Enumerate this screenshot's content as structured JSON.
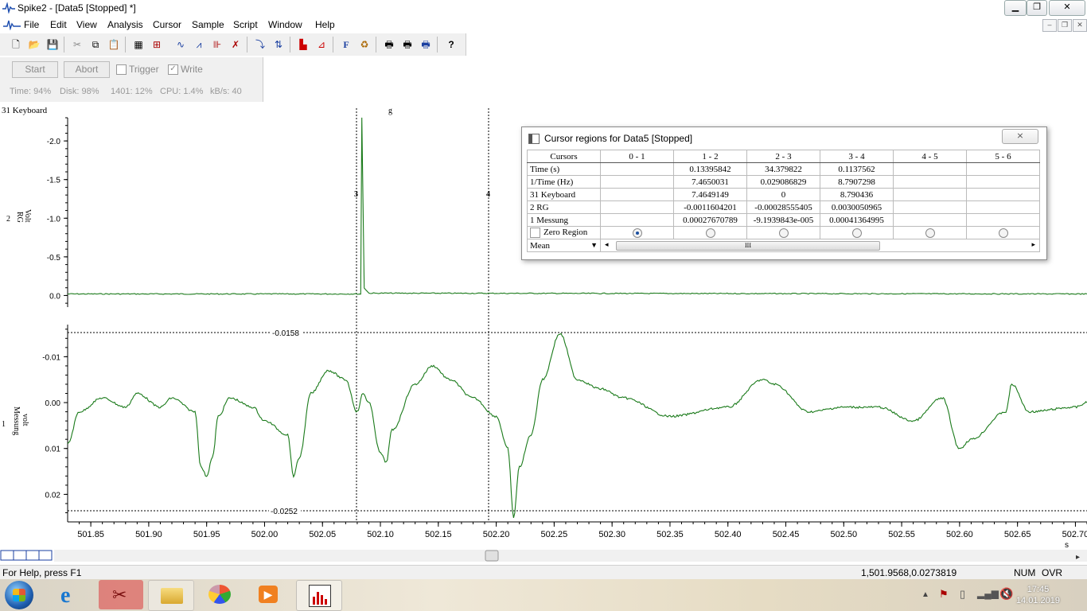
{
  "window": {
    "title": "Spike2 - [Data5 [Stopped] *]"
  },
  "menu": [
    "File",
    "Edit",
    "View",
    "Analysis",
    "Cursor",
    "Sample",
    "Script",
    "Window",
    "Help"
  ],
  "sample_bar": {
    "start_label": "Start",
    "abort_label": "Abort",
    "trigger_label": "Trigger",
    "write_label": "Write"
  },
  "sample_status": {
    "time": "Time: 94%",
    "disk": "Disk:  98%",
    "buffer": "1401: 12%",
    "cpu": "CPU:  1.4%",
    "kbs": "kB/s:  40"
  },
  "channels": {
    "keyboard": {
      "label": "31 Keyboard",
      "marker": "g"
    },
    "rg": {
      "number": "2",
      "name": "RG",
      "unit": "Volt",
      "ticks": [
        "-2.0",
        "-1.5",
        "-1.0",
        "-0.5",
        "0.0"
      ]
    },
    "messung": {
      "number": "1",
      "name": "Messung",
      "unit": "volt",
      "ticks": [
        "-0.01",
        "0.00",
        "0.01",
        "0.02"
      ]
    }
  },
  "cursors": {
    "c3": "3",
    "c4": "4",
    "hcursor_top": "-0.0158",
    "hcursor_bottom": "-0.0252"
  },
  "x_axis": {
    "ticks": [
      "501.85",
      "501.90",
      "501.95",
      "502.00",
      "502.05",
      "502.10",
      "502.15",
      "502.20",
      "502.25",
      "502.30",
      "502.35",
      "502.40",
      "502.45",
      "502.50",
      "502.55",
      "502.60",
      "502.65",
      "502.70"
    ],
    "unit": "s"
  },
  "trace_color": "#1a7a1a",
  "chart_data": {
    "type": "line",
    "series": [
      {
        "name": "RG",
        "x_range": [
          501.83,
          502.71
        ],
        "description_points": [
          [
            501.83,
            -0.02
          ],
          [
            502.083,
            -0.02
          ],
          [
            502.084,
            -2.3
          ],
          [
            502.086,
            -0.1
          ],
          [
            502.09,
            -0.03
          ],
          [
            502.71,
            -0.02
          ]
        ]
      },
      {
        "name": "Messung",
        "x": [
          501.83,
          501.84,
          501.86,
          501.88,
          501.89,
          501.91,
          501.92,
          501.94,
          501.945,
          501.95,
          501.955,
          501.96,
          501.97,
          501.99,
          502.0,
          502.02,
          502.025,
          502.03,
          502.04,
          502.055,
          502.07,
          502.08,
          502.085,
          502.09,
          502.1,
          502.105,
          502.11,
          502.13,
          502.145,
          502.16,
          502.18,
          502.2,
          502.21,
          502.215,
          502.22,
          502.23,
          502.24,
          502.255,
          502.27,
          502.29,
          502.31,
          502.35,
          502.4,
          502.43,
          502.44,
          502.47,
          502.5,
          502.53,
          502.56,
          502.585,
          502.6,
          502.61,
          502.64,
          502.645,
          502.66,
          502.7,
          502.71
        ],
        "y": [
          0.009,
          0.002,
          -0.001,
          0.001,
          -0.002,
          0.001,
          -0.001,
          0.002,
          0.014,
          0.016,
          0.012,
          0.003,
          -0.001,
          0.001,
          0.004,
          0.007,
          0.016,
          0.012,
          -0.002,
          -0.007,
          -0.005,
          0.002,
          -0.002,
          0.0,
          0.011,
          0.013,
          0.006,
          -0.004,
          -0.008,
          -0.005,
          -0.001,
          0.003,
          0.01,
          0.025,
          0.014,
          0.007,
          -0.005,
          -0.015,
          -0.005,
          -0.003,
          -0.001,
          0.003,
          0.001,
          -0.005,
          -0.004,
          0.002,
          0.001,
          0.001,
          0.004,
          -0.001,
          0.01,
          0.008,
          0.002,
          -0.004,
          0.002,
          0.001,
          0.0
        ]
      }
    ],
    "xlabel": "s",
    "xlim": [
      501.83,
      502.71
    ],
    "rg_ylim": [
      -2.3,
      0.15
    ],
    "messung_ylim": [
      -0.017,
      0.026
    ]
  },
  "dialog": {
    "title": "Cursor regions for Data5 [Stopped]",
    "close_label": "⨯",
    "columns": [
      "Cursors",
      "0 - 1",
      "1 - 2",
      "2 - 3",
      "3 - 4",
      "4 - 5",
      "5 - 6"
    ],
    "rows": [
      {
        "label": "Time (s)",
        "values": [
          "",
          "0.13395842",
          "34.379822",
          "0.1137562",
          "",
          ""
        ]
      },
      {
        "label": "1/Time (Hz)",
        "values": [
          "",
          "7.4650031",
          "0.029086829",
          "8.7907298",
          "",
          ""
        ]
      },
      {
        "label": "31 Keyboard",
        "values": [
          "",
          "7.4649149",
          "0",
          "8.790436",
          "",
          ""
        ]
      },
      {
        "label": "2 RG",
        "values": [
          "",
          "-0.0011604201",
          "-0.00028555405",
          "0.0030050965",
          "",
          ""
        ]
      },
      {
        "label": "1 Messung",
        "values": [
          "",
          "0.00027670789",
          "-9.1939843e-005",
          "0.00041364995",
          "",
          ""
        ]
      }
    ],
    "zero_region_label": "Zero Region",
    "mode_label": "Mean",
    "scroll_grip": "III"
  },
  "status": {
    "help": "For Help, press F1",
    "position": "1,501.9568,0.0273819",
    "num": "NUM",
    "ovr": "OVR"
  },
  "taskbar": {
    "time": "17:45",
    "date": "14.01.2019"
  }
}
